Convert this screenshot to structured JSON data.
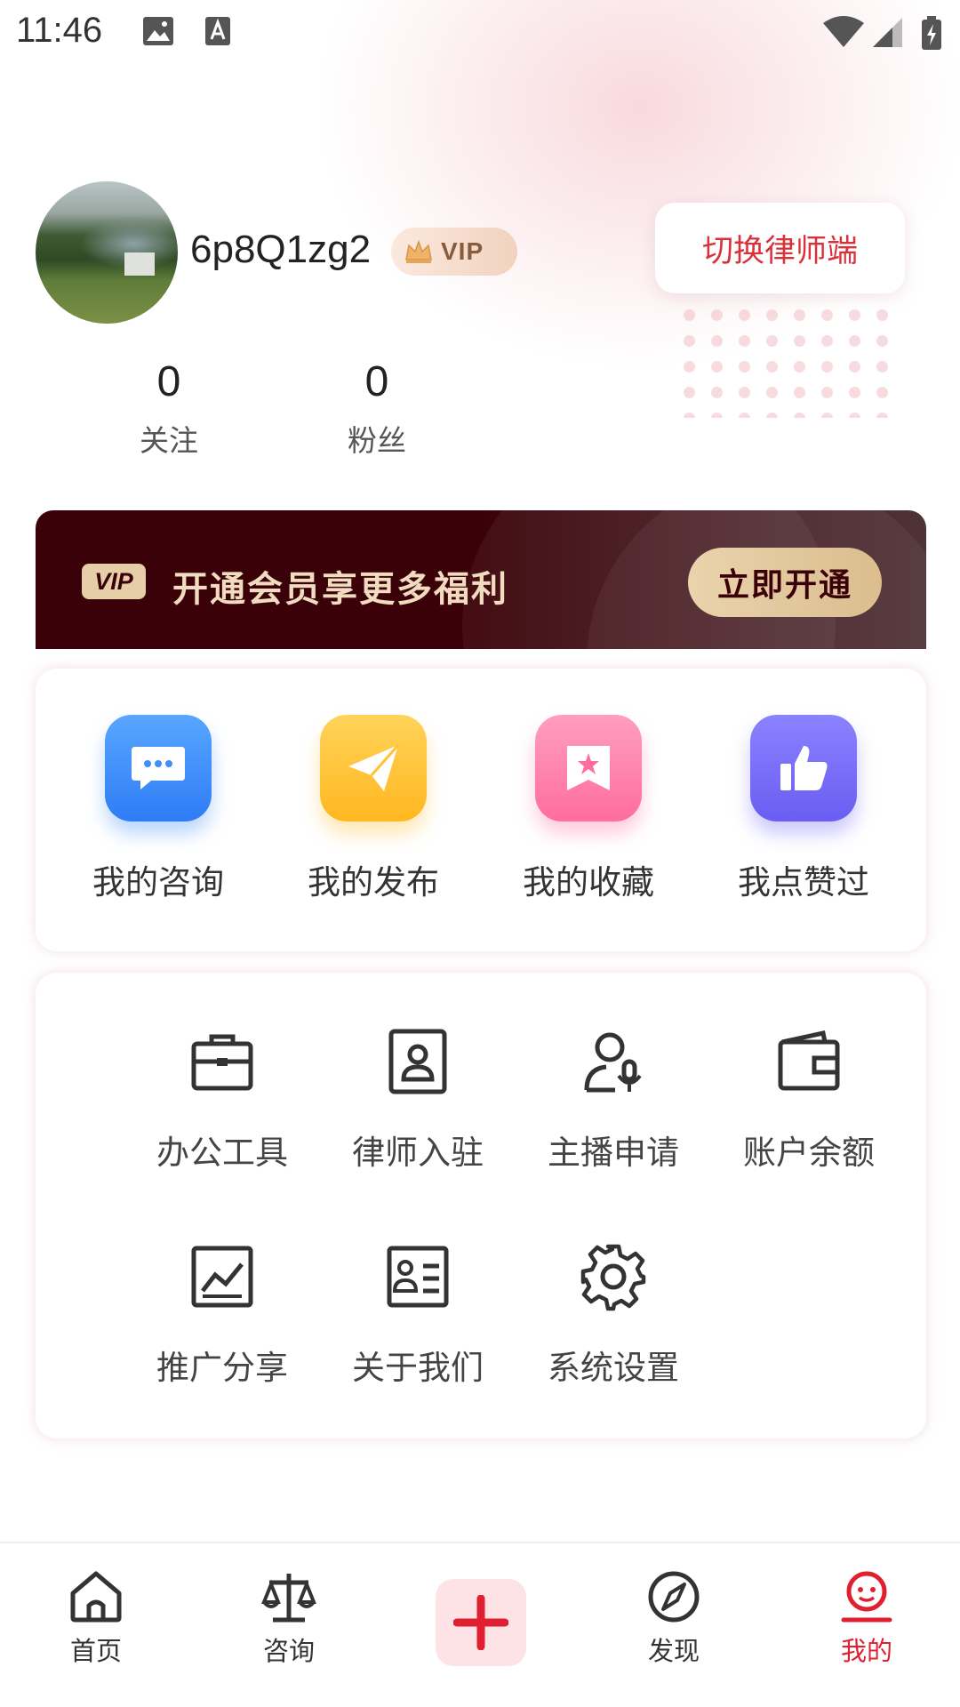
{
  "status_bar": {
    "time": "11:46"
  },
  "profile": {
    "username": "6p8Q1zg2",
    "vip_badge": "VIP",
    "switch_button": "切换律师端",
    "stats": [
      {
        "value": "0",
        "label": "关注"
      },
      {
        "value": "0",
        "label": "粉丝"
      }
    ]
  },
  "vip_banner": {
    "mark": "VIP",
    "text": "开通会员享更多福利",
    "button": "立即开通"
  },
  "quick_actions": [
    {
      "label": "我的咨询",
      "icon": "chat-bubble-icon",
      "color": "#3f8ffb"
    },
    {
      "label": "我的发布",
      "icon": "paper-plane-icon",
      "color": "#ffc233"
    },
    {
      "label": "我的收藏",
      "icon": "bookmark-star-icon",
      "color": "#ff7fa8"
    },
    {
      "label": "我点赞过",
      "icon": "thumbs-up-icon",
      "color": "#7a6ff5"
    }
  ],
  "tools": [
    {
      "label": "办公工具",
      "icon": "briefcase-icon"
    },
    {
      "label": "律师入驻",
      "icon": "id-badge-icon"
    },
    {
      "label": "主播申请",
      "icon": "user-mic-icon"
    },
    {
      "label": "账户余额",
      "icon": "wallet-icon"
    },
    {
      "label": "推广分享",
      "icon": "chart-line-icon"
    },
    {
      "label": "关于我们",
      "icon": "id-card-icon"
    },
    {
      "label": "系统设置",
      "icon": "gear-icon"
    }
  ],
  "bottom_nav": [
    {
      "label": "首页",
      "icon": "home-icon"
    },
    {
      "label": "咨询",
      "icon": "scale-icon"
    },
    {
      "label": "",
      "icon": "plus-icon"
    },
    {
      "label": "发现",
      "icon": "compass-icon"
    },
    {
      "label": "我的",
      "icon": "profile-icon",
      "active": true
    }
  ],
  "colors": {
    "accent_red": "#e02030",
    "vip_banner_bg": "#3a0208",
    "vip_gold": "#e6cfa8"
  }
}
